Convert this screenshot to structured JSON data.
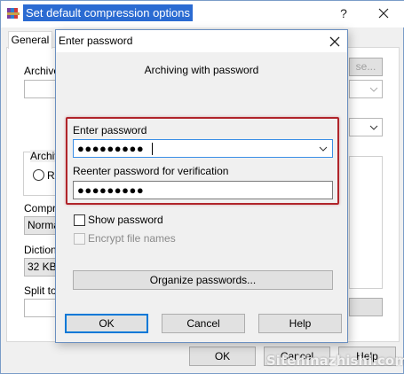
{
  "background_window": {
    "title": "Set default compression options",
    "help_glyph": "?",
    "tab_general": "General",
    "archive_label": "Archive",
    "browse_label": "se...",
    "archive_format_label": "Archive",
    "rar_label": "RA",
    "compression_label": "Compre",
    "compression_value": "Norma",
    "dictionary_label": "Dictiona",
    "dictionary_value": "32 KB",
    "split_label": "Split to",
    "ok_label": "OK",
    "cancel_label": "Cancel",
    "help_label": "Help"
  },
  "dialog": {
    "title": "Enter password",
    "header": "Archiving with password",
    "enter_password_label": "Enter password",
    "password_value": "●●●●●●●●●",
    "reenter_label": "Reenter password for verification",
    "reenter_value": "●●●●●●●●●",
    "show_password_label": "Show password",
    "show_password_checked": false,
    "encrypt_names_label": "Encrypt file names",
    "encrypt_names_checked": false,
    "encrypt_names_enabled": false,
    "organize_label": "Organize passwords...",
    "ok_label": "OK",
    "cancel_label": "Cancel",
    "help_label": "Help"
  },
  "watermark": "Sitehinazhishi.com",
  "colors": {
    "highlight": "#b0242a",
    "title_selection": "#2b6bd2",
    "focus_border": "#0078d7"
  },
  "icons": {
    "app": "winrar-books-icon",
    "close": "close-icon",
    "dropdown": "chevron-down-icon"
  }
}
